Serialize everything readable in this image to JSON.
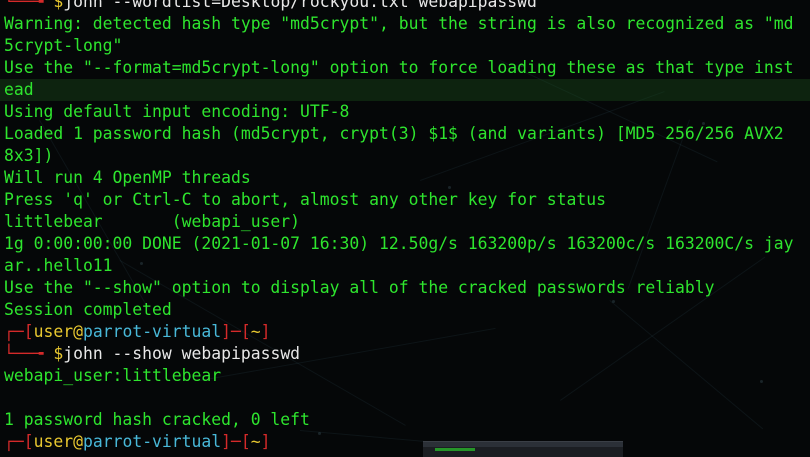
{
  "terminal": {
    "lines": [
      {
        "type": "cmd",
        "tree": "└──╼ ",
        "dollar": "$",
        "text": "john --wordlist=Desktop/rockyou.txt webapipasswd"
      },
      {
        "type": "out",
        "text": "Warning: detected hash type \"md5crypt\", but the string is also recognized as \"md"
      },
      {
        "type": "out",
        "text": "5crypt-long\""
      },
      {
        "type": "out",
        "text": "Use the \"--format=md5crypt-long\" option to force loading these as that type inst"
      },
      {
        "type": "out",
        "text": "ead",
        "highlight": true
      },
      {
        "type": "out",
        "text": "Using default input encoding: UTF-8"
      },
      {
        "type": "out",
        "text": "Loaded 1 password hash (md5crypt, crypt(3) $1$ (and variants) [MD5 256/256 AVX2"
      },
      {
        "type": "out",
        "text": "8x3])"
      },
      {
        "type": "out",
        "text": "Will run 4 OpenMP threads"
      },
      {
        "type": "out",
        "text": "Press 'q' or Ctrl-C to abort, almost any other key for status"
      },
      {
        "type": "out",
        "text": "littlebear       (webapi_user)"
      },
      {
        "type": "out",
        "text": "1g 0:00:00:00 DONE (2021-01-07 16:30) 12.50g/s 163200p/s 163200c/s 163200C/s jay"
      },
      {
        "type": "out",
        "text": "ar..hello11"
      },
      {
        "type": "out",
        "text": "Use the \"--show\" option to display all of the cracked passwords reliably"
      },
      {
        "type": "out",
        "text": "Session completed"
      },
      {
        "type": "prompt",
        "tree": "┌─",
        "open": "[",
        "user": "user",
        "at": "@",
        "host": "parrot-virtual",
        "mid": "]─[",
        "cwd": "~",
        "close": "]"
      },
      {
        "type": "cmd",
        "tree": "└──╼ ",
        "dollar": "$",
        "text": "john --show webapipasswd"
      },
      {
        "type": "out",
        "text": "webapi_user:littlebear"
      },
      {
        "type": "out",
        "text": ""
      },
      {
        "type": "out",
        "text": "1 password hash cracked, 0 left"
      },
      {
        "type": "prompt",
        "tree": "┌─",
        "open": "[",
        "user": "user",
        "at": "@",
        "host": "parrot-virtual",
        "mid": "]─[",
        "cwd": "~",
        "close": "]"
      }
    ]
  },
  "colors": {
    "output": "#2ee52e",
    "tree": "#d42a2a",
    "user": "#e8c830",
    "host": "#48b8d8",
    "command": "#e8e8e8",
    "background": "#050708"
  }
}
